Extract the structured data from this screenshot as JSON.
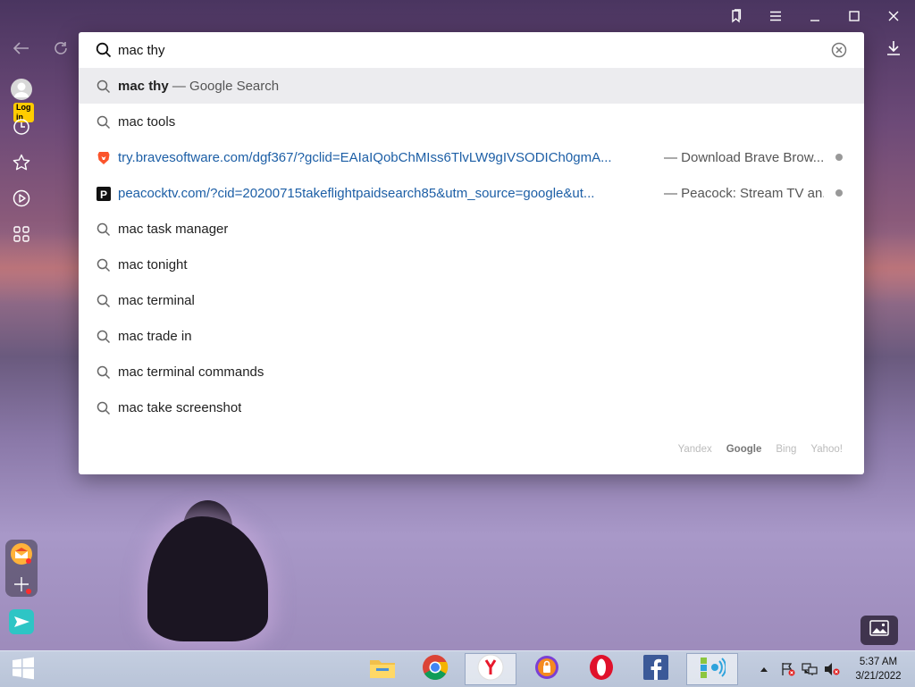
{
  "colors": {
    "accent": "#1d5fa6",
    "highlight_row": "#ececef",
    "login_badge": "#ffcc00",
    "brave_orange": "#fb542b"
  },
  "window": {
    "controls": [
      {
        "icon": "bookmarks-panel-icon"
      },
      {
        "icon": "hamburger-menu-icon"
      },
      {
        "icon": "minimize-icon"
      },
      {
        "icon": "maximize-icon"
      },
      {
        "icon": "close-icon"
      }
    ]
  },
  "nav": {
    "back_icon": "arrow-left-icon",
    "reload_icon": "reload-icon",
    "downloads_icon": "download-icon"
  },
  "sidebar": {
    "login_label": "Log in",
    "items": [
      {
        "icon": "history-clock-icon"
      },
      {
        "icon": "bookmark-star-icon"
      },
      {
        "icon": "video-play-icon"
      },
      {
        "icon": "apps-grid-icon"
      }
    ],
    "dock": [
      {
        "icon": "mail-icon"
      },
      {
        "icon": "plus-icon"
      },
      {
        "icon": "paper-plane-icon"
      }
    ]
  },
  "omnibox": {
    "input_value": "mac thy",
    "clear_icon": "clear-x-icon",
    "suggestions": [
      {
        "type": "search",
        "bold": "mac thy",
        "suffix": " — Google Search",
        "highlighted": true
      },
      {
        "type": "search",
        "text": "mac tools"
      },
      {
        "type": "url",
        "favicon": "brave-lion-icon",
        "url": "try.bravesoftware.com/dgf367/?gclid=EAIaIQobChMIss6TlvLW9gIVSODICh0gmA...",
        "desc": "— Download Brave Brow..."
      },
      {
        "type": "url",
        "favicon": "peacock-p-icon",
        "url": "peacocktv.com/?cid=20200715takeflightpaidsearch85&utm_source=google&ut...",
        "desc": "— Peacock: Stream TV an..."
      },
      {
        "type": "search",
        "text": "mac task manager"
      },
      {
        "type": "search",
        "text": "mac tonight"
      },
      {
        "type": "search",
        "text": "mac terminal"
      },
      {
        "type": "search",
        "text": "mac trade in"
      },
      {
        "type": "search",
        "text": "mac terminal commands"
      },
      {
        "type": "search",
        "text": "mac take screenshot"
      }
    ],
    "engines": [
      {
        "name": "Yandex",
        "active": false
      },
      {
        "name": "Google",
        "active": true
      },
      {
        "name": "Bing",
        "active": false
      },
      {
        "name": "Yahoo!",
        "active": false
      }
    ]
  },
  "wallpaper_button_icon": "image-icon",
  "taskbar": {
    "start_icon": "windows-start-icon",
    "apps": [
      {
        "icon": "file-explorer-icon",
        "active": false
      },
      {
        "icon": "chrome-icon",
        "active": false
      },
      {
        "icon": "yandex-browser-icon",
        "active": true
      },
      {
        "icon": "avast-browser-icon",
        "active": false
      },
      {
        "icon": "opera-icon",
        "active": false
      },
      {
        "icon": "facebook-icon",
        "active": false
      },
      {
        "icon": "network-app-icon",
        "active": false
      }
    ],
    "tray_icons": [
      "show-hidden-icons-icon",
      "action-center-flag-icon",
      "network-icon",
      "volume-muted-icon"
    ],
    "clock": {
      "time": "5:37 AM",
      "date": "3/21/2022"
    }
  }
}
